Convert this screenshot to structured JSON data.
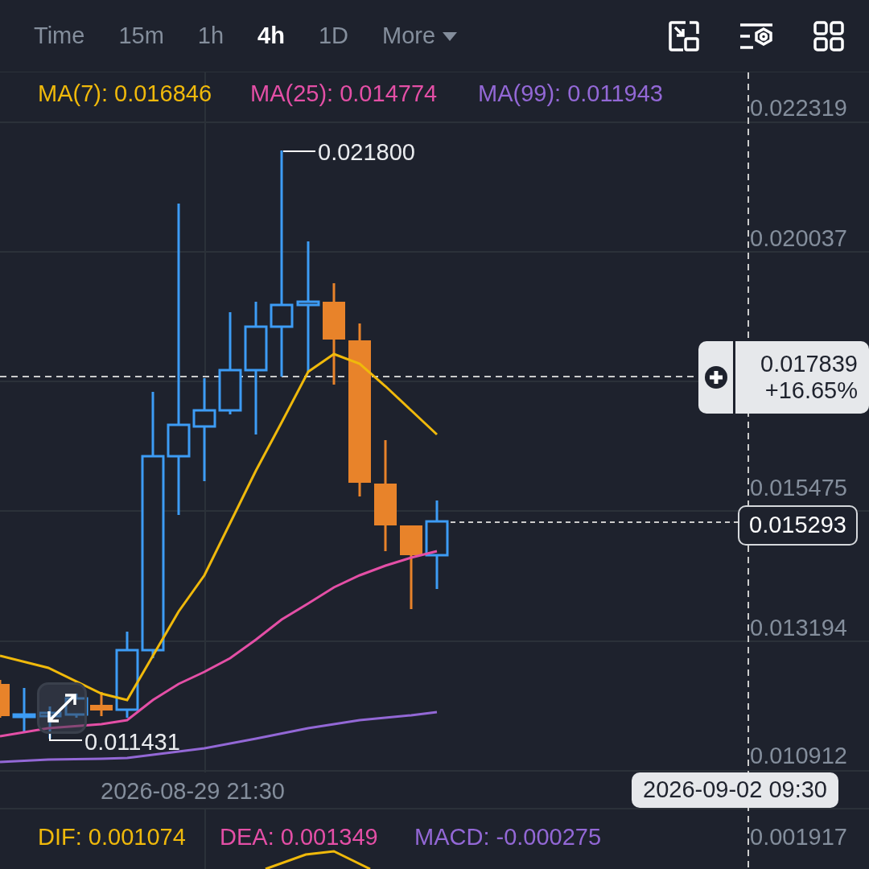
{
  "toolbar": {
    "tabs": [
      {
        "label": "Time",
        "selected": false,
        "kind": "plain"
      },
      {
        "label": "15m",
        "selected": false,
        "kind": "plain"
      },
      {
        "label": "1h",
        "selected": false,
        "kind": "plain"
      },
      {
        "label": "4h",
        "selected": true,
        "kind": "plain"
      },
      {
        "label": "1D",
        "selected": false,
        "kind": "plain"
      },
      {
        "label": "More",
        "selected": false,
        "kind": "dropdown"
      }
    ]
  },
  "chart": {
    "ma_legend": [
      {
        "label": "MA(7): 0.016846",
        "color": "#f0b90b"
      },
      {
        "label": "MA(25): 0.014774",
        "color": "#e44fa6"
      },
      {
        "label": "MA(99): 0.011943",
        "color": "#9368d6"
      }
    ],
    "y_ticks": [
      "0.022319",
      "0.020037",
      "0.015475",
      "0.013194",
      "0.010912"
    ],
    "high_label": "0.021800",
    "low_label": "0.011431",
    "crosshair_tag": {
      "price": "0.017839",
      "change": "+16.65%"
    },
    "last_price": "0.015293",
    "time_label": "2026-08-29 21:30",
    "crosshair_time": "2026-09-02 09:30"
  },
  "macd": {
    "legend": [
      {
        "label": "DIF: 0.001074",
        "color": "#f0b90b"
      },
      {
        "label": "DEA: 0.001349",
        "color": "#e44fa6"
      },
      {
        "label": "MACD: -0.000275",
        "color": "#9368d6"
      }
    ],
    "y_tick": "0.001917"
  }
}
